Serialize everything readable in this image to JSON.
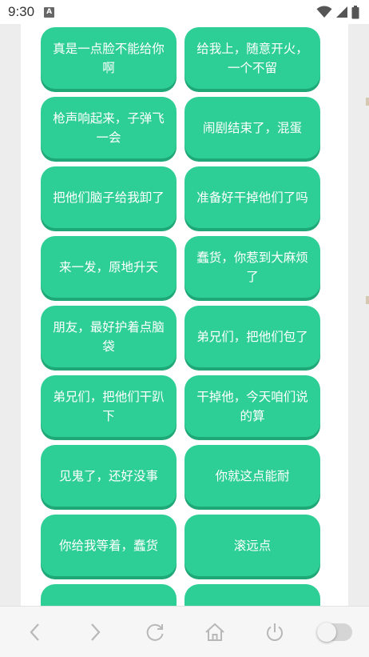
{
  "status_bar": {
    "time": "9:30",
    "notification_icon": "A"
  },
  "buttons": [
    "真是一点脸不能给你啊",
    "给我上，随意开火，一个不留",
    "枪声响起来，子弹飞一会",
    "闹剧结束了，混蛋",
    "把他们脑子给我卸了",
    "准备好干掉他们了吗",
    "来一发，原地升天",
    "蠢货，你惹到大麻烦了",
    "朋友，最好护着点脑袋",
    "弟兄们，把他们包了",
    "弟兄们，把他们干趴下",
    "干掉他，今天咱们说的算",
    "见鬼了，还好没事",
    "你就这点能耐",
    "你给我等着，蠢货",
    "滚远点",
    "",
    ""
  ],
  "colors": {
    "button": "#2ecf96",
    "button_shadow": "#1fa877",
    "nav_icon": "#b8b8b8"
  },
  "nav": {
    "icons": [
      "back-icon",
      "forward-icon",
      "reload-icon",
      "home-icon",
      "power-icon",
      "toggle-switch"
    ]
  }
}
